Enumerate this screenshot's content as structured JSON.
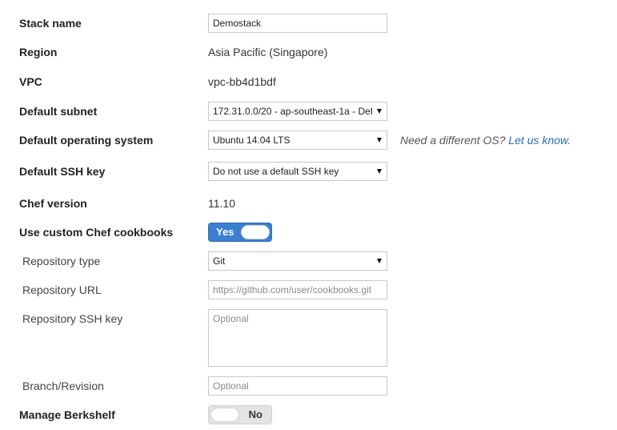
{
  "form": {
    "stack_name": {
      "label": "Stack name",
      "value": "Demostack"
    },
    "region": {
      "label": "Region",
      "value": "Asia Pacific (Singapore)"
    },
    "vpc": {
      "label": "VPC",
      "value": "vpc-bb4d1bdf"
    },
    "default_subnet": {
      "label": "Default subnet",
      "value": "172.31.0.0/20 - ap-southeast-1a - Def"
    },
    "default_os": {
      "label": "Default operating system",
      "value": "Ubuntu 14.04 LTS",
      "hint_text": "Need a different OS?",
      "hint_link": "Let us know."
    },
    "default_ssh_key": {
      "label": "Default SSH key",
      "value": "Do not use a default SSH key"
    },
    "chef_version": {
      "label": "Chef version",
      "value": "11.10"
    },
    "custom_cookbooks": {
      "label": "Use custom Chef cookbooks",
      "state_label": "Yes"
    },
    "repository_type": {
      "label": "Repository type",
      "value": "Git"
    },
    "repository_url": {
      "label": "Repository URL",
      "placeholder": "https://github.com/user/cookbooks.git"
    },
    "repository_ssh_key": {
      "label": "Repository SSH key",
      "placeholder": "Optional"
    },
    "branch_revision": {
      "label": "Branch/Revision",
      "placeholder": "Optional"
    },
    "manage_berkshelf": {
      "label": "Manage Berkshelf",
      "state_label": "No"
    }
  },
  "colors": {
    "toggle_on": "#3b7fd0",
    "toggle_off": "#e3e3e3",
    "link": "#2a6db2"
  }
}
